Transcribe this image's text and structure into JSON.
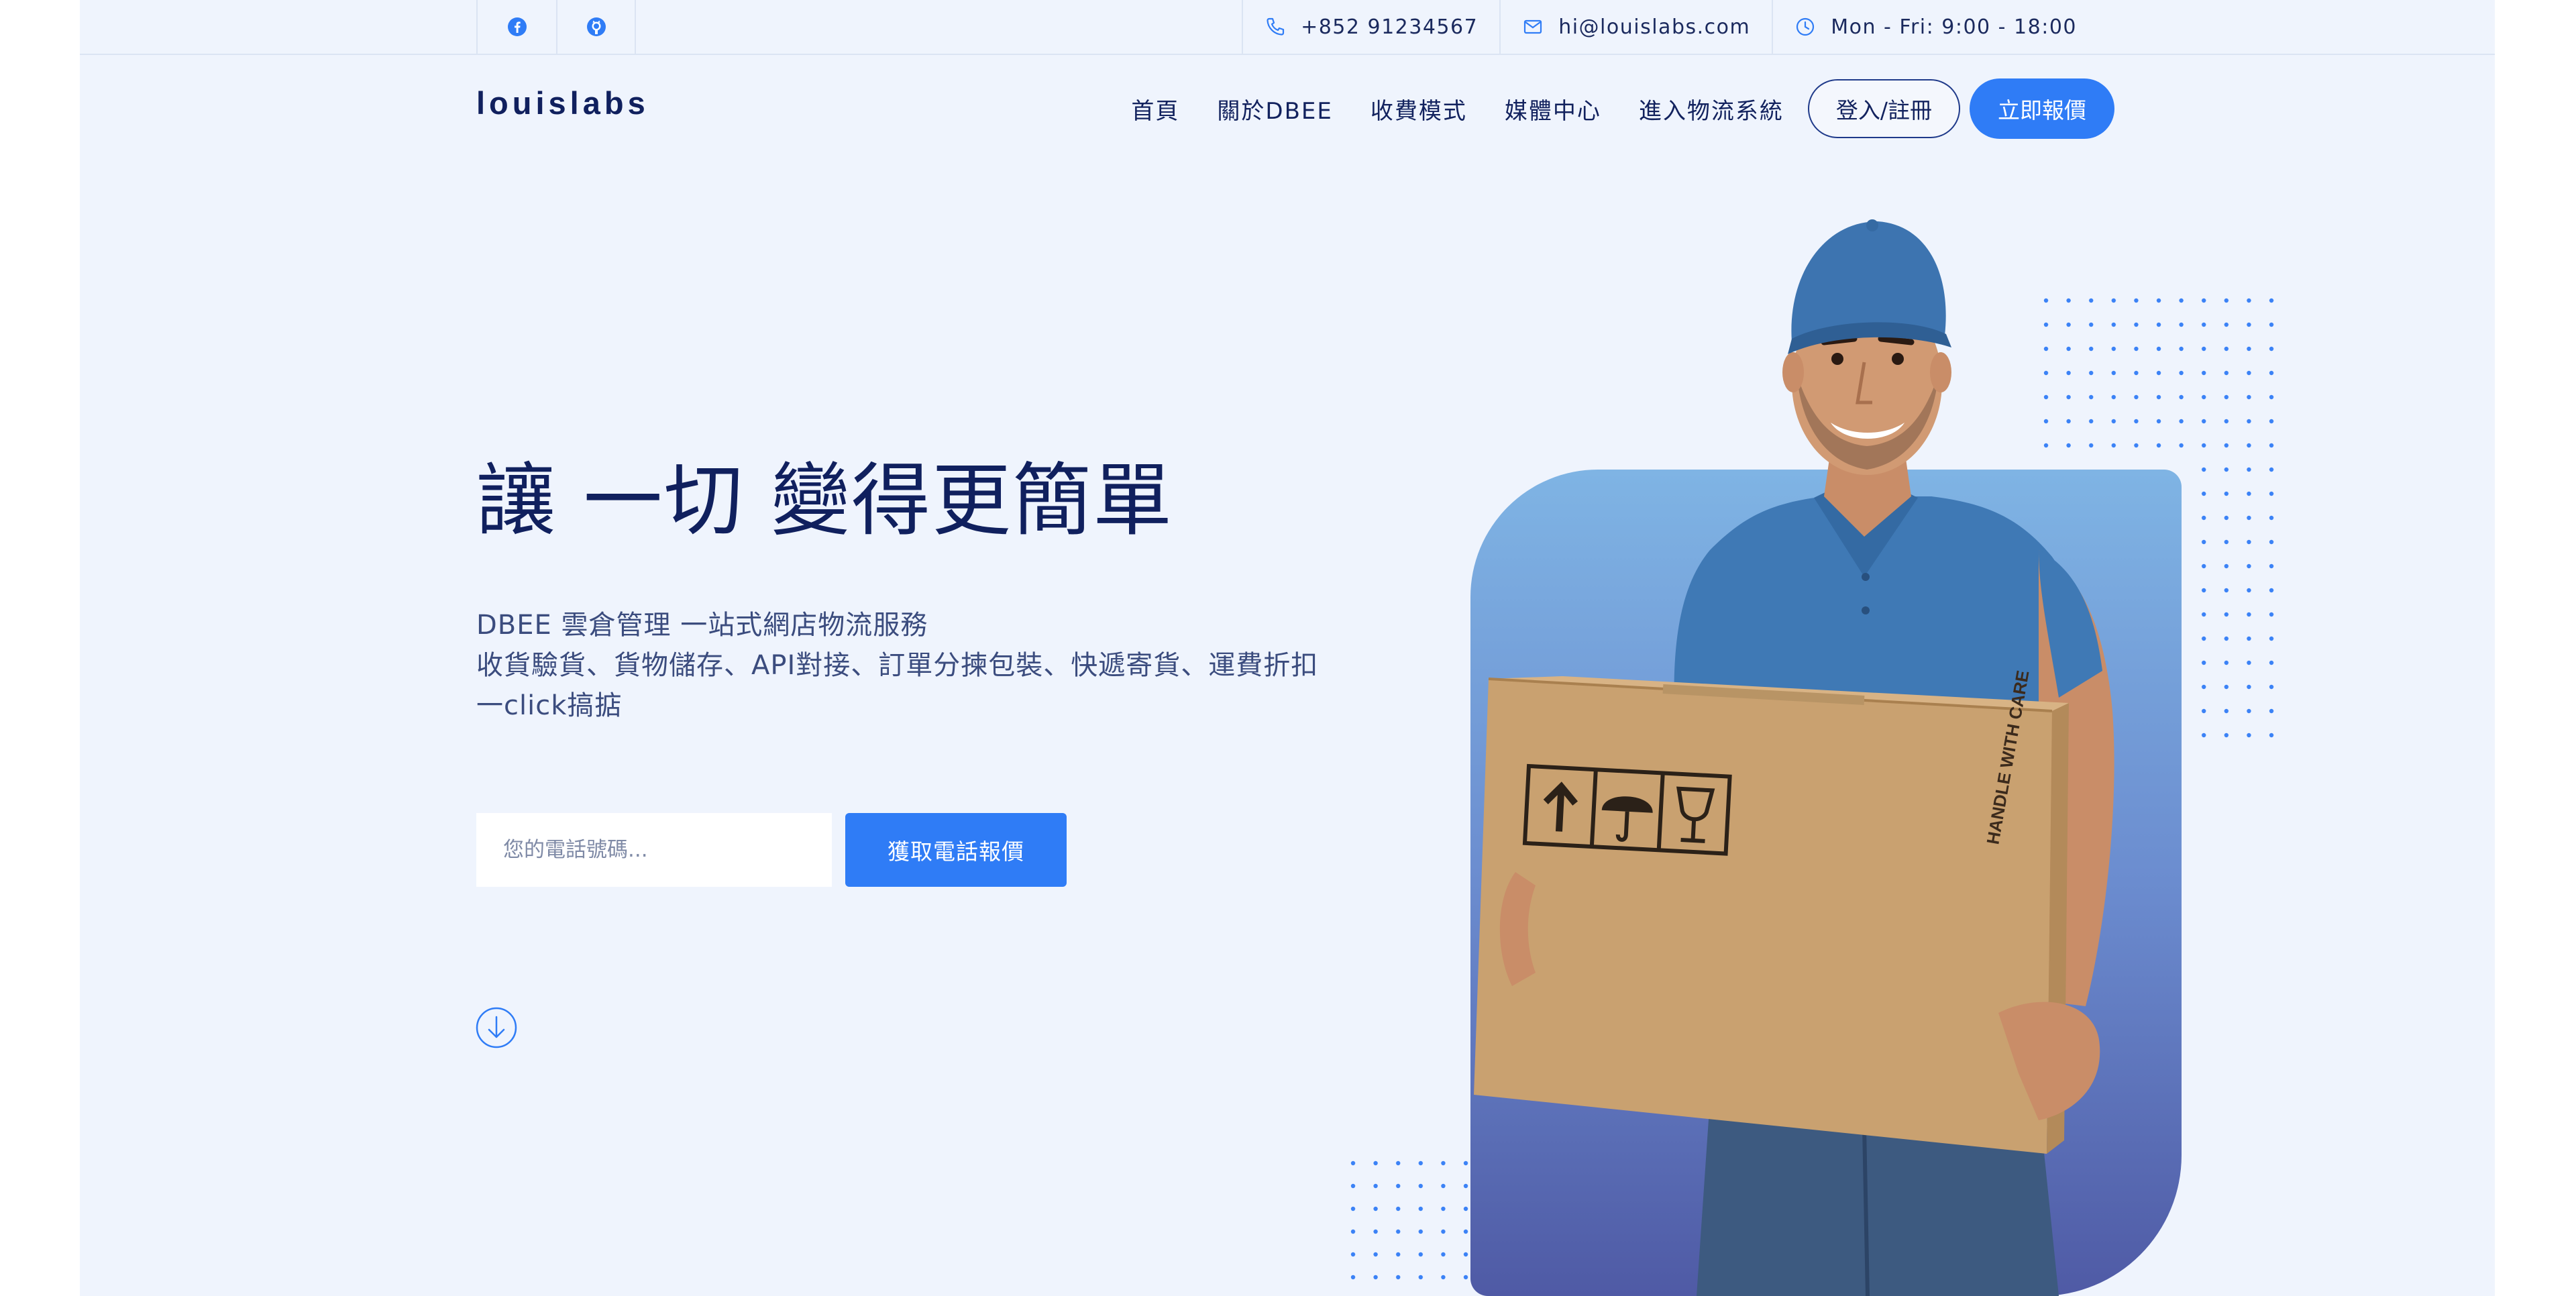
{
  "topbar": {
    "socials": [
      {
        "icon": "facebook-icon"
      },
      {
        "icon": "github-icon"
      }
    ],
    "phone": "+852 91234567",
    "email": "hi@louislabs.com",
    "hours": "Mon - Fri: 9:00 - 18:00"
  },
  "nav": {
    "logo": "louislabs",
    "links": [
      "首頁",
      "關於DBEE",
      "收費模式",
      "媒體中心",
      "進入物流系統"
    ],
    "login_label": "登入/註冊",
    "quote_label": "立即報價"
  },
  "hero": {
    "title": "讓 一切 變得更簡單",
    "lines": [
      "DBEE 雲倉管理 一站式網店物流服務",
      "收貨驗貨、貨物儲存、API對接、訂單分揀包裝、快遞寄貨、運費折扣 一click搞掂"
    ],
    "phone_placeholder": "您的電話號碼...",
    "submit_label": "獲取電話報價",
    "box_label": "HANDLE WITH CARE"
  },
  "colors": {
    "accent": "#2f7cf6",
    "navy": "#10205e",
    "background": "#eff4fd",
    "gradient_top": "#7fb4e4",
    "gradient_bottom": "#4f5aa5"
  }
}
